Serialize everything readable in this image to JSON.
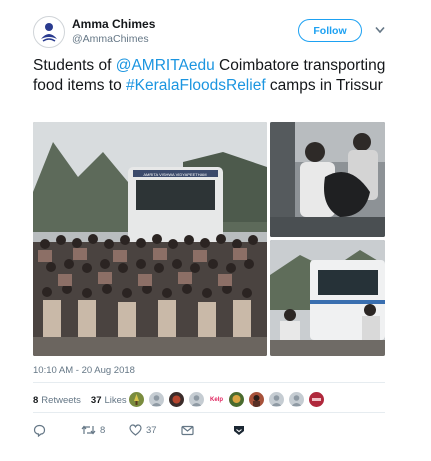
{
  "author": {
    "name": "Amma Chimes",
    "handle": "@AmmaChimes"
  },
  "header": {
    "follow_label": "Follow",
    "menu_icon": "chevron-down-icon"
  },
  "tweet": {
    "text_part1": "Students of ",
    "mention": "@AMRITAedu",
    "text_part2": " Coimbatore transporting food items to ",
    "hashtag": "#KeralaFloodsRelief",
    "text_part3": " camps in Trissur"
  },
  "photos": {
    "main_bus_text": "AMRITA VISHWA VIDYAPEETHAM",
    "count": 3
  },
  "timestamp": "10:10 AM - 20 Aug 2018",
  "stats": {
    "retweets_count": "8",
    "retweets_label": "Retweets",
    "likes_count": "37",
    "likes_label": "Likes",
    "liker_badge_text": "Kelp"
  },
  "actions": {
    "reply_icon": "reply-icon",
    "retweet_count": "8",
    "like_count": "37",
    "dm_icon": "envelope-icon",
    "bookmark_icon": "bookmark-icon"
  },
  "colors": {
    "accent": "#1da1f2",
    "link": "#1b95e0",
    "muted": "#657786",
    "divider": "#e6ecf0"
  }
}
